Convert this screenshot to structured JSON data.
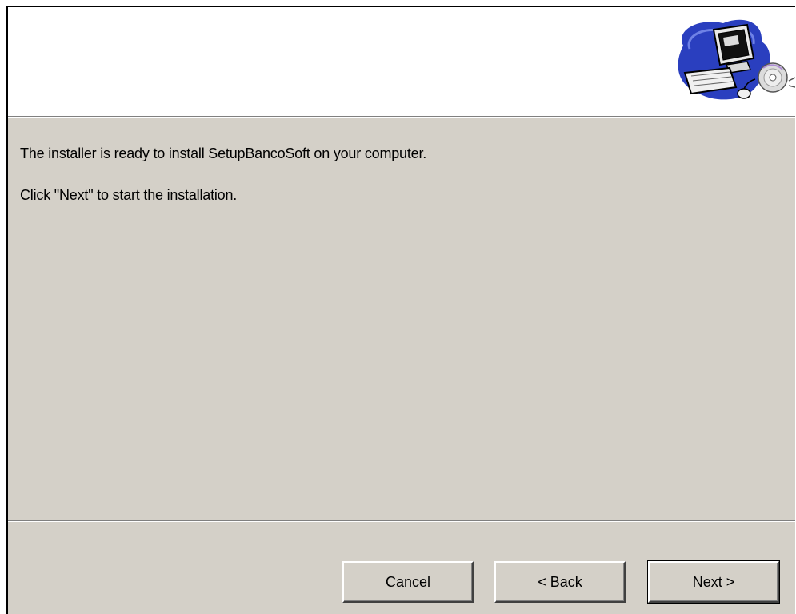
{
  "window": {
    "body_text": "The installer is ready to install SetupBancoSoft on your computer.",
    "instruction_text": "Click \"Next\" to start the installation."
  },
  "banner": {
    "logo_icon": "computer-with-cd-icon"
  },
  "buttons": {
    "cancel_label": "Cancel",
    "back_label": "< Back",
    "next_label": "Next >"
  },
  "colors": {
    "dialog_background": "#d4d0c8",
    "banner_background": "#ffffff",
    "logo_blue": "#2a3fbf"
  }
}
